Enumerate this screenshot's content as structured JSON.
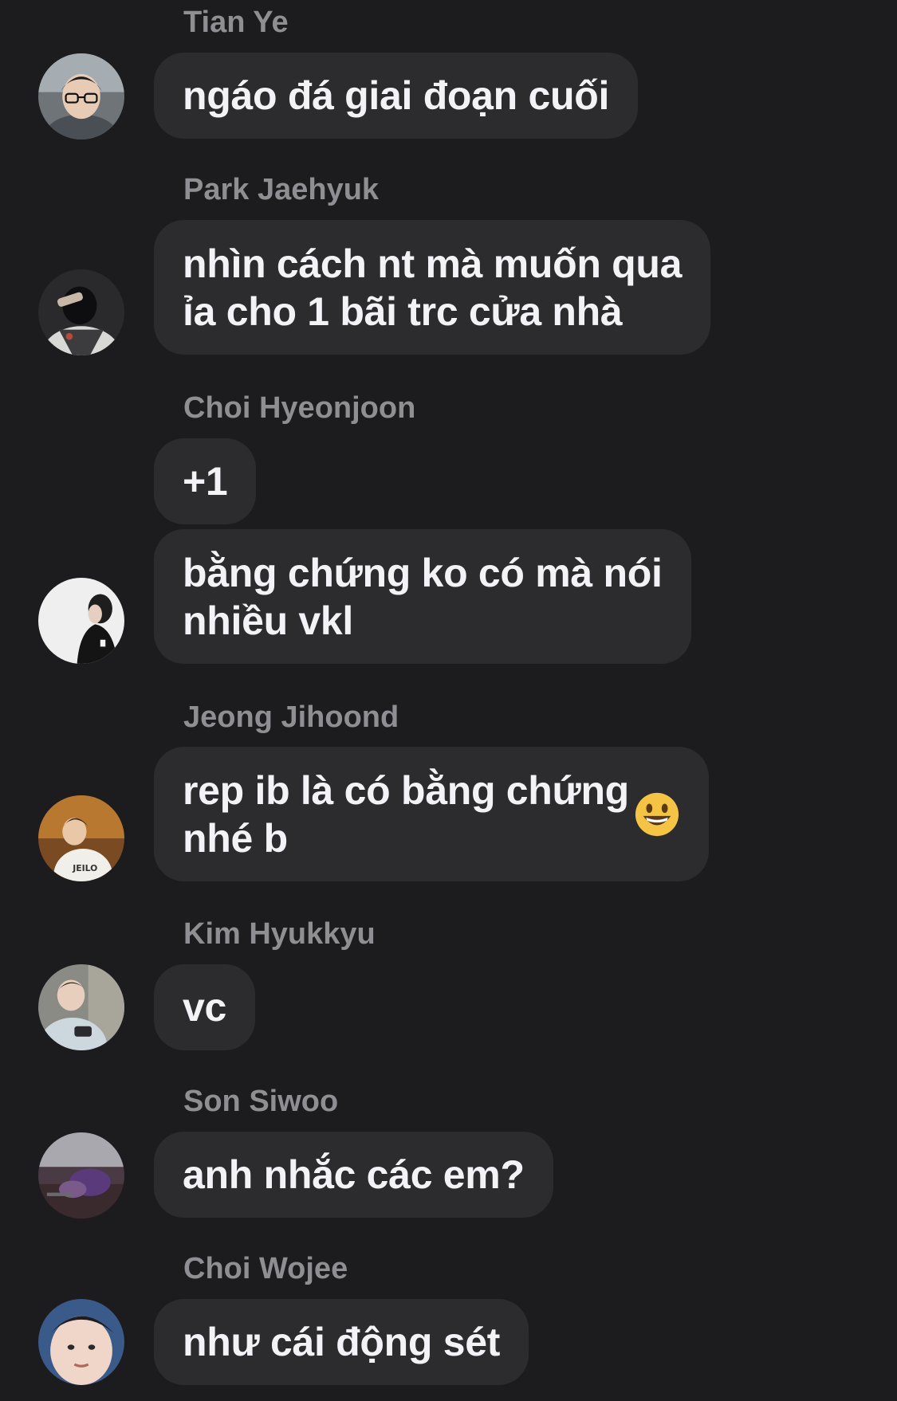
{
  "messages": [
    {
      "sender": "Tian Ye",
      "avatar": "avatar-tian-ye",
      "bubbles": [
        "ngáo đá giai đoạn cuối"
      ]
    },
    {
      "sender": "Park Jaehyuk",
      "avatar": "avatar-park-jaehyuk",
      "bubbles": [
        "nhìn cách nt mà muốn qua\nỉa cho 1 bãi trc cửa nhà"
      ]
    },
    {
      "sender": "Choi Hyeonjoon",
      "avatar": "avatar-choi-hyeonjoon",
      "bubbles": [
        "+1",
        "bằng chứng ko có mà nói\nnhiều vkl"
      ]
    },
    {
      "sender": "Jeong Jihoond",
      "avatar": "avatar-jeong-jihoond",
      "bubbles": [
        "rep ib là có bằng chứng\nnhé b"
      ],
      "emoji": "grinning-face-icon"
    },
    {
      "sender": "Kim Hyukkyu",
      "avatar": "avatar-kim-hyukkyu",
      "bubbles": [
        "vc"
      ]
    },
    {
      "sender": "Son Siwoo",
      "avatar": "avatar-son-siwoo",
      "bubbles": [
        "anh nhắc các em?"
      ]
    },
    {
      "sender": "Choi Wojee",
      "avatar": "avatar-choi-wojee",
      "bubbles": [
        "như cái động sét"
      ]
    }
  ],
  "colors": {
    "background": "#1c1c1e",
    "bubble": "#2c2c2e",
    "text": "#f2f2f7",
    "sender": "#8e8e93"
  }
}
